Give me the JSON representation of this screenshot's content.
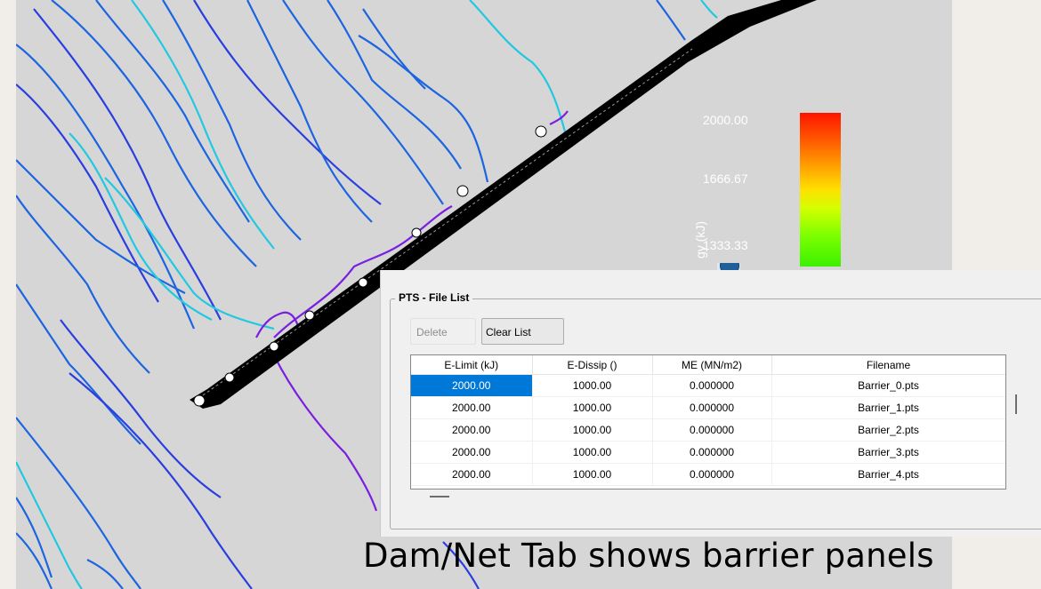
{
  "legend": {
    "title": "gy (kJ)",
    "ticks": [
      "2000.00",
      "1666.67",
      "1333.33"
    ]
  },
  "panel": {
    "group_title": "PTS - File List",
    "delete_label": "Delete",
    "clear_label": "Clear List",
    "columns": [
      "E-Limit (kJ)",
      "E-Dissip ()",
      "ME (MN/m2)",
      "Filename"
    ],
    "rows": [
      [
        "2000.00",
        "1000.00",
        "0.000000",
        "Barrier_0.pts"
      ],
      [
        "2000.00",
        "1000.00",
        "0.000000",
        "Barrier_1.pts"
      ],
      [
        "2000.00",
        "1000.00",
        "0.000000",
        "Barrier_2.pts"
      ],
      [
        "2000.00",
        "1000.00",
        "0.000000",
        "Barrier_3.pts"
      ],
      [
        "2000.00",
        "1000.00",
        "0.000000",
        "Barrier_4.pts"
      ]
    ]
  },
  "caption": "Dam/Net Tab shows barrier panels",
  "colors": {
    "viewport_bg": "#d6d6d6",
    "selection": "#0078d7",
    "trajectory_blue": "#1c64e0",
    "trajectory_cyan": "#22c8e0",
    "trajectory_purple": "#7a1fe0"
  }
}
